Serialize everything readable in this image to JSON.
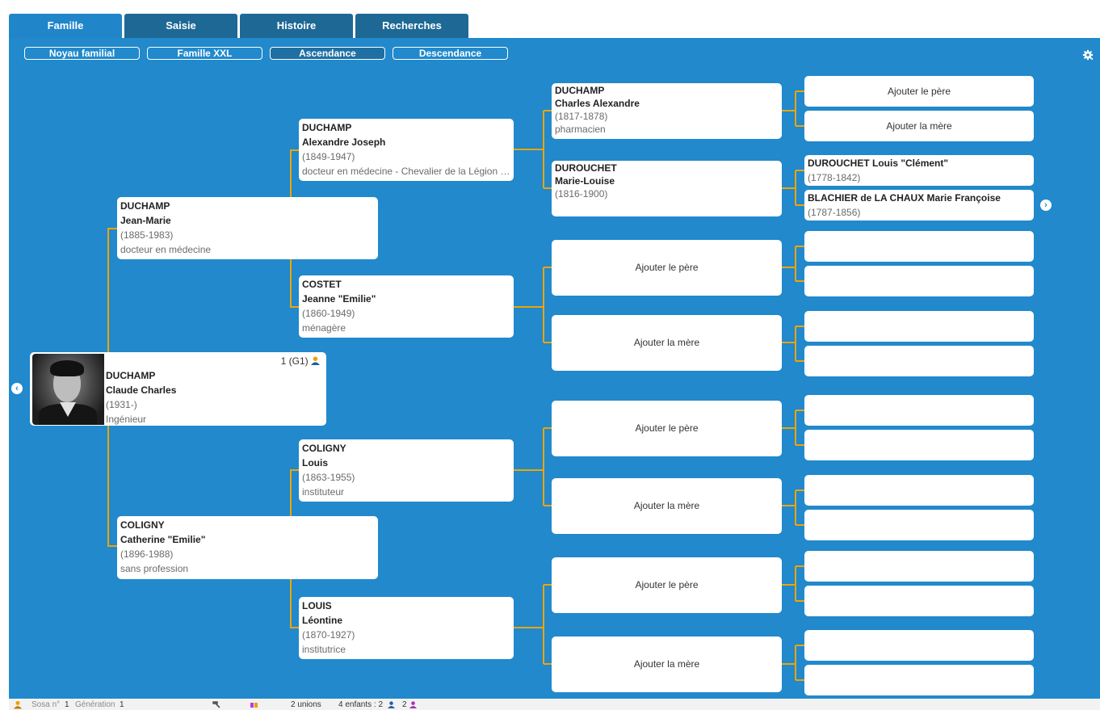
{
  "tabs": [
    {
      "label": "Famille",
      "active": true
    },
    {
      "label": "Saisie",
      "active": false
    },
    {
      "label": "Histoire",
      "active": false
    },
    {
      "label": "Recherches",
      "active": false
    }
  ],
  "view_buttons": [
    {
      "label": "Noyau familial",
      "active": false
    },
    {
      "label": "Famille XXL",
      "active": false
    },
    {
      "label": "Ascendance",
      "active": true
    },
    {
      "label": "Descendance",
      "active": false
    }
  ],
  "root": {
    "sosa": "1 (G1)",
    "surname": "DUCHAMP",
    "given": "Claude Charles",
    "dates": "(1931-)",
    "occupation": "Ingénieur"
  },
  "gen2": {
    "father": {
      "surname": "DUCHAMP",
      "given": "Jean-Marie",
      "dates": "(1885-1983)",
      "occupation": "docteur en médecine"
    },
    "mother": {
      "surname": "COLIGNY",
      "given": "Catherine \"Emilie\"",
      "dates": "(1896-1988)",
      "occupation": "sans profession"
    }
  },
  "gen3": {
    "pf": {
      "surname": "DUCHAMP",
      "given": "Alexandre Joseph",
      "dates": "(1849-1947)",
      "occupation": "docteur en médecine - Chevalier de la Légion d'H..."
    },
    "pm": {
      "surname": "COSTET",
      "given": "Jeanne \"Emilie\"",
      "dates": "(1860-1949)",
      "occupation": "ménagère"
    },
    "mf": {
      "surname": "COLIGNY",
      "given": "Louis",
      "dates": "(1863-1955)",
      "occupation": "instituteur"
    },
    "mm": {
      "surname": "LOUIS",
      "given": "Léontine",
      "dates": "(1870-1927)",
      "occupation": "institutrice"
    }
  },
  "gen4": {
    "pff": {
      "surname": "DUCHAMP",
      "given": "Charles Alexandre",
      "dates": "(1817-1878)",
      "occupation": "pharmacien"
    },
    "pfm": {
      "surname": "DUROUCHET",
      "given": "Marie-Louise",
      "dates": "(1816-1900)"
    }
  },
  "gen5": {
    "pfmf": {
      "name": "DUROUCHET Louis \"Clément\"",
      "dates": "(1778-1842)"
    },
    "pfmm": {
      "name": "BLACHIER de LA CHAUX Marie Françoise",
      "dates": "(1787-1856)"
    }
  },
  "add_father": "Ajouter le père",
  "add_mother": "Ajouter la mère",
  "footer": {
    "sosa_label": "Sosa n°",
    "sosa_value": "1",
    "generation_label": "Génération",
    "generation_value": "1",
    "unions": "2 unions",
    "children": "4 enfants : 2",
    "daughters": "2"
  },
  "colors": {
    "background": "#2189cc",
    "tab": "#1e6896",
    "tab_active": "#2185c9",
    "connector": "#f0a400"
  }
}
